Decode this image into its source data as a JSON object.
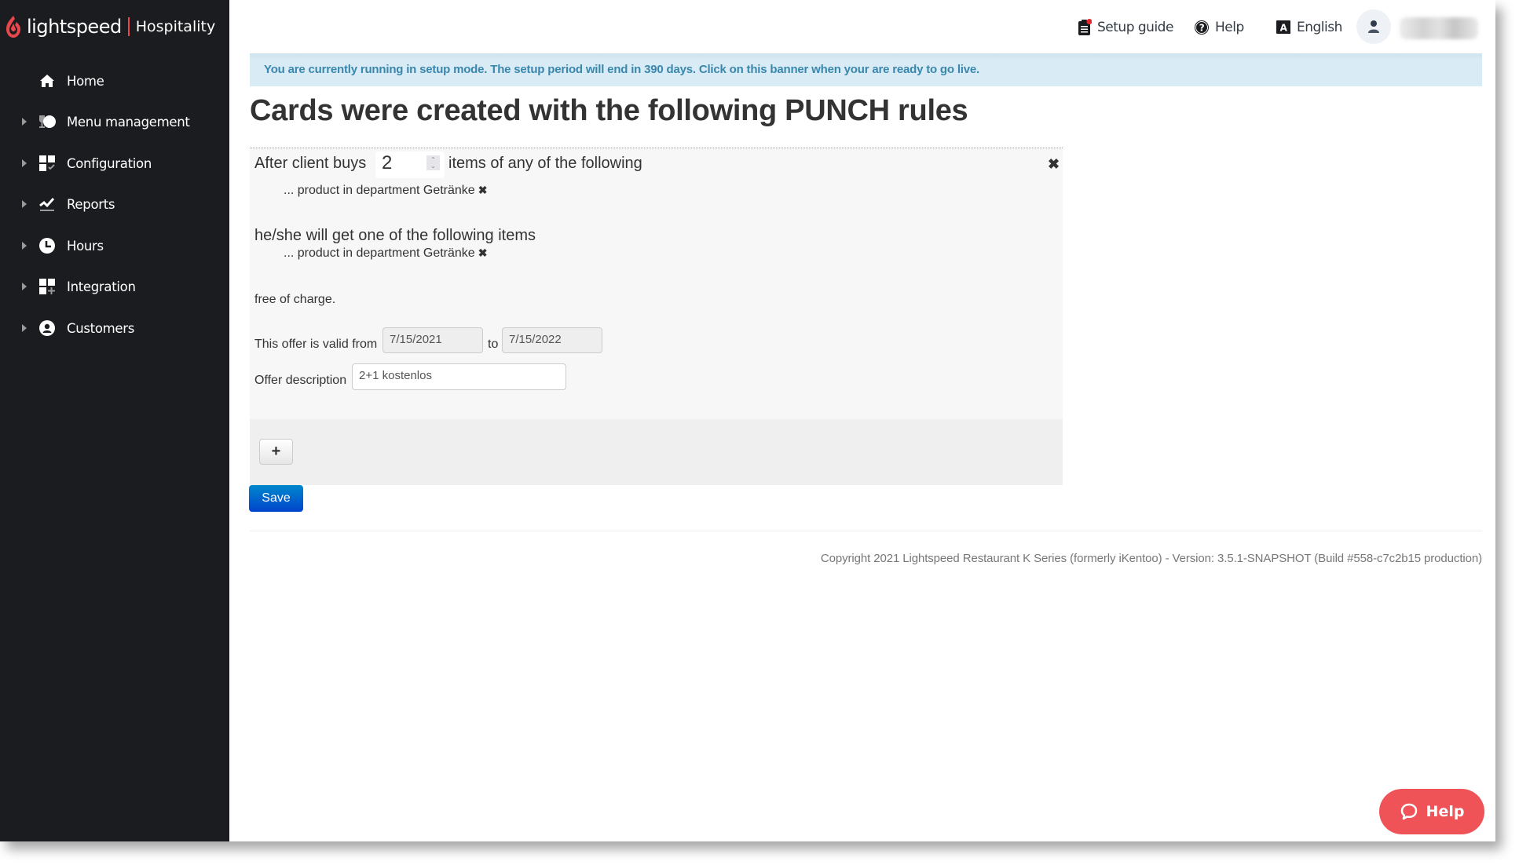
{
  "brand": {
    "name": "lightspeed",
    "product": "Hospitality",
    "accent_color": "#e8474c"
  },
  "sidebar": {
    "items": [
      {
        "label": "Home",
        "icon": "home-icon",
        "expandable": false
      },
      {
        "label": "Menu management",
        "icon": "menu-management-icon",
        "expandable": true
      },
      {
        "label": "Configuration",
        "icon": "configuration-icon",
        "expandable": true
      },
      {
        "label": "Reports",
        "icon": "reports-icon",
        "expandable": true
      },
      {
        "label": "Hours",
        "icon": "clock-icon",
        "expandable": true
      },
      {
        "label": "Integration",
        "icon": "integration-icon",
        "expandable": true
      },
      {
        "label": "Customers",
        "icon": "customer-icon",
        "expandable": true
      }
    ]
  },
  "topbar": {
    "setup_guide": "Setup guide",
    "help": "Help",
    "language": "English",
    "language_badge": "A"
  },
  "banner": {
    "text": "You are currently running in setup mode. The setup period will end in 390 days. Click on this banner when your are ready to go live."
  },
  "page": {
    "title": "Cards were created with the following PUNCH rules"
  },
  "rule": {
    "buy_prefix": "After client buys",
    "buy_quantity": "2",
    "buy_suffix": "items of any of the following",
    "buy_items": [
      "... product in department Getränke"
    ],
    "get_heading": "he/she will get one of the following items",
    "get_items": [
      "... product in department Getränke"
    ],
    "free_text": "free of charge.",
    "valid_label": "This offer is valid from",
    "valid_from": "7/15/2021",
    "valid_to_label": "to",
    "valid_to": "7/15/2022",
    "description_label": "Offer description",
    "description_value": "2+1 kostenlos",
    "remove_symbol": "✖",
    "close_symbol": "✖"
  },
  "actions": {
    "add_label": "+",
    "save_label": "Save"
  },
  "footer": {
    "copyright": "Copyright 2021 Lightspeed Restaurant K Series (formerly iKentoo) - Version: 3.5.1-SNAPSHOT (Build #558-c7c2b15 production)"
  },
  "help_widget": {
    "label": "Help",
    "color": "#ef5357"
  }
}
